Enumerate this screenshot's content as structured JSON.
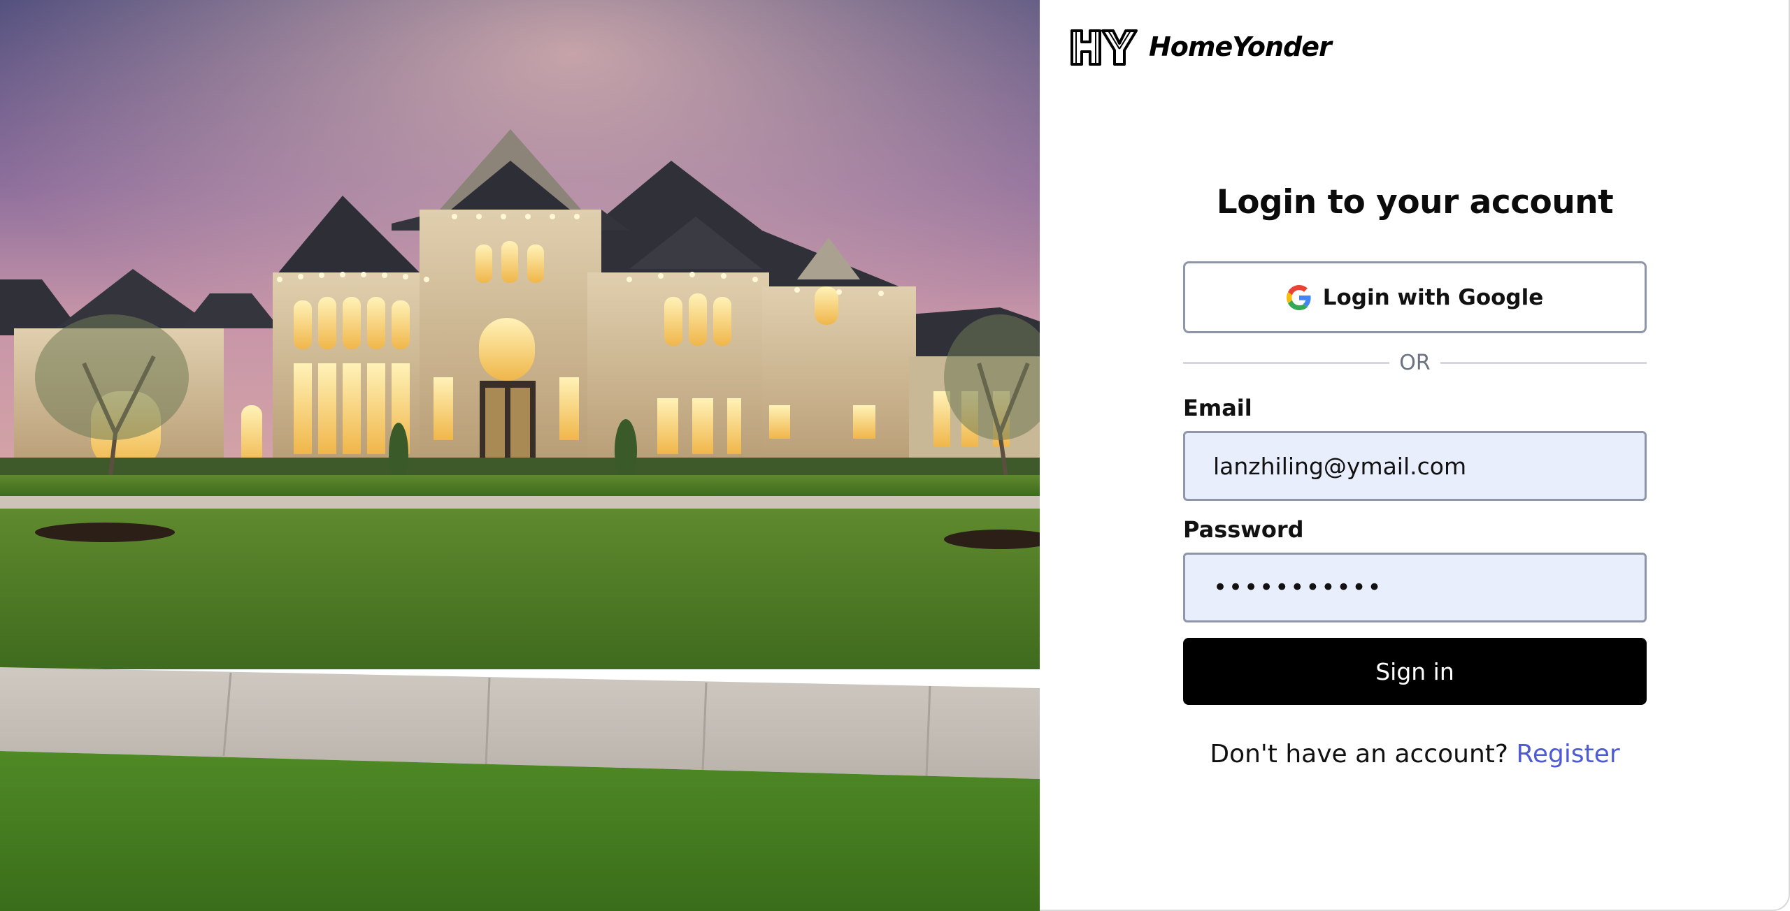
{
  "brand": {
    "monogram": "HY",
    "name": "HomeYonder"
  },
  "login": {
    "title": "Login to your account",
    "google_button_label": "Login with Google",
    "divider_text": "OR",
    "email_label": "Email",
    "email_value": "lanzhiling@ymail.com",
    "password_label": "Password",
    "password_value": "•••••••••••",
    "signin_label": "Sign in",
    "register_prompt": "Don't have an account?",
    "register_link": "Register"
  },
  "colors": {
    "accent_link": "#4f5bd5",
    "primary_button": "#000000",
    "input_background": "#e8eefc"
  },
  "icons": {
    "google": "google-icon",
    "logo": "homeyonder-logo-icon"
  }
}
